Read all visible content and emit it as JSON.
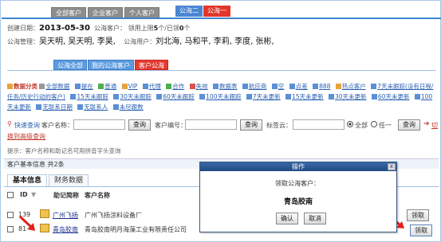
{
  "top_tabs": [
    "全部客户",
    "企业客户",
    "个人客户"
  ],
  "pool_tabs": [
    {
      "label": "公海二",
      "color": "#4a86d0"
    },
    {
      "label": "公海一",
      "color": "#e2362a"
    }
  ],
  "info": {
    "created_label": "创建日期：",
    "created_date": "2013-05-30",
    "pool_client_label": "公海客户：",
    "claim_label": "领用上限",
    "claim_max": "5",
    "claim_unit": "个/已领",
    "claim_used": "0",
    "claim_end": "个",
    "admin_label": "公海管理：",
    "admins": "吴天明, 吴天明, 李昊,",
    "users_label": "公海用户：",
    "users": "刘北海, 马和平, 李莉, 李度, 张彬,"
  },
  "sub_tabs": [
    "公海全部",
    "我的公海客户",
    "客户公海"
  ],
  "categories": {
    "label": "数据分类",
    "items": [
      {
        "t": "全部数据",
        "c": "gray"
      },
      {
        "t": "提在",
        "c": "blue"
      },
      {
        "t": "普通",
        "c": "green"
      },
      {
        "t": "VIP",
        "c": "orange"
      },
      {
        "t": "代理",
        "c": "blue"
      },
      {
        "t": "合作",
        "c": "green"
      },
      {
        "t": "失效",
        "c": "red"
      },
      {
        "t": "数据表",
        "c": "blue"
      },
      {
        "t": "航应商",
        "c": "blue"
      },
      {
        "t": "空",
        "c": "blue"
      },
      {
        "t": "点差",
        "c": "blue"
      },
      {
        "t": "888",
        "c": "blue"
      },
      {
        "t": "热点客户",
        "c": "orange"
      },
      {
        "t": "7天未跟踪(没有日程/任务/历史行动的客户)",
        "c": "blue"
      },
      {
        "t": "15天未跟踪",
        "c": "blue"
      },
      {
        "t": "30天未跟踪",
        "c": "blue"
      },
      {
        "t": "60天未跟踪",
        "c": "blue"
      },
      {
        "t": "100天未跟踪",
        "c": "blue"
      },
      {
        "t": "7天未更新",
        "c": "blue"
      },
      {
        "t": "15天未更新",
        "c": "blue"
      },
      {
        "t": "30天未更新",
        "c": "blue"
      },
      {
        "t": "60天未更新",
        "c": "blue"
      },
      {
        "t": "100天未更新",
        "c": "blue"
      },
      {
        "t": "无联系日期",
        "c": "blue"
      },
      {
        "t": "无联系人",
        "c": "blue"
      },
      {
        "t": "未尽跟数",
        "c": "blue"
      }
    ]
  },
  "search": {
    "label": "快速查询",
    "client_name_label": "客户名称：",
    "query_btn": "查询",
    "client_no_label": "客户编号：",
    "query_btn2": "查询",
    "tag_label": "标签云：",
    "radio_all": "全部",
    "radio_any": "任一",
    "query_btn3": "查询",
    "advanced_a": "切",
    "advanced_b": "换到高级查询"
  },
  "hint": "提示：客户名称和助记名可用拼音字头查询",
  "table_header": "客户基本信息  共2条",
  "bottom_tabs": [
    "基本信息",
    "财务数据"
  ],
  "columns": {
    "id": "ID",
    "code": "助记简称",
    "name": "客户名称"
  },
  "rows": [
    {
      "id": "139",
      "code": "广州飞扬",
      "name": "广州飞扬涂料设备厂",
      "action": "领取"
    },
    {
      "id": "81",
      "code": "青岛胶南",
      "name": "青岛胶南明月海藻工业有限责任公司",
      "action": "领取"
    }
  ],
  "dialog": {
    "title": "操作",
    "message": "领取公海客户：",
    "client": "青岛胶南",
    "ok": "确认",
    "cancel": "取消",
    "close": "x"
  }
}
